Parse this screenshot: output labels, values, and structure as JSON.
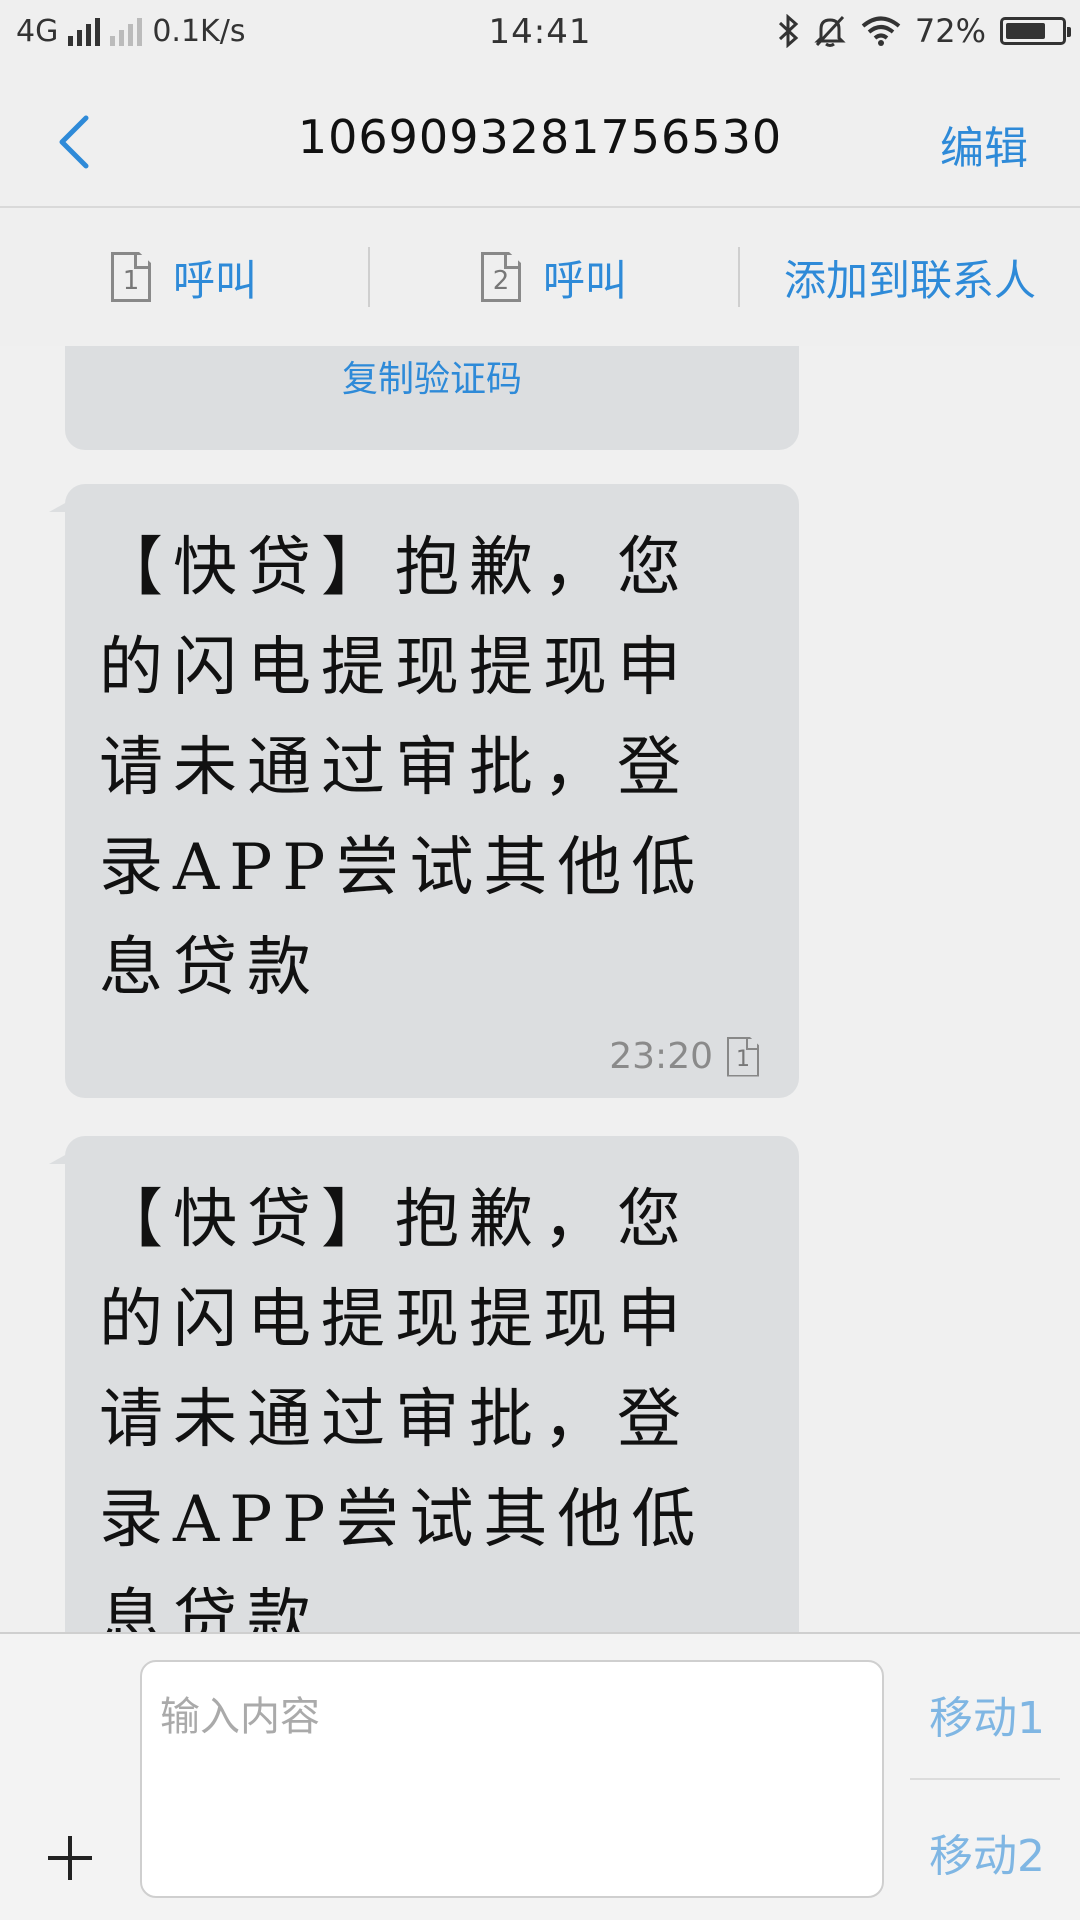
{
  "status_bar": {
    "network": "4G",
    "speed": "0.1K/s",
    "time": "14:41",
    "battery": "72%",
    "battery_level": 0.72
  },
  "header": {
    "title": "1069093281756530",
    "edit_label": "编辑"
  },
  "actions": {
    "call1_label": "呼叫",
    "sim1": "1",
    "call2_label": "呼叫",
    "sim2": "2",
    "add_contact_label": "添加到联系人"
  },
  "messages": {
    "copy_code_label": "复制验证码",
    "items": [
      {
        "text": "【快贷】抱歉，您的闪电提现提现申请未通过审批，登录APP尝试其他低息贷款",
        "time": "23:20",
        "sim": "1"
      },
      {
        "text": "【快贷】抱歉，您的闪电提现提现申请未通过审批，登录APP尝试其他低息贷款"
      }
    ]
  },
  "composer": {
    "placeholder": "输入内容",
    "send1_label": "移动1",
    "send2_label": "移动2"
  },
  "colors": {
    "accent": "#2e8ad8",
    "bubble": "#dcdee0",
    "background": "#f0f0f0"
  }
}
